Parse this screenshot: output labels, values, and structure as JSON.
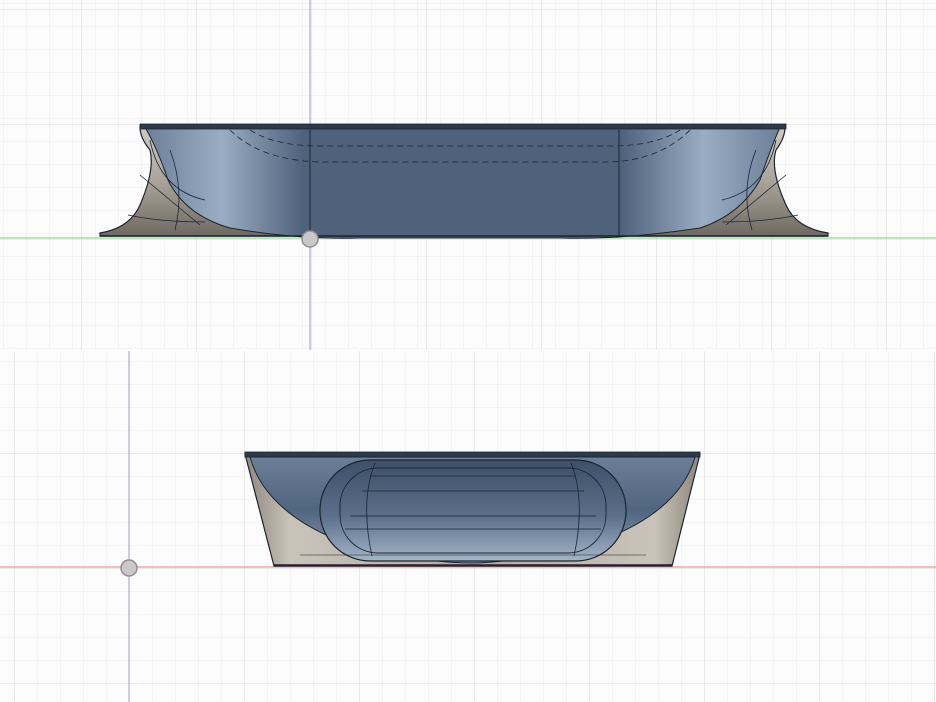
{
  "viewports": [
    {
      "id": "front",
      "axis_colors": {
        "vertical": "#9a9ae6",
        "horizontal": "#7fd07f"
      }
    },
    {
      "id": "side",
      "axis_colors": {
        "vertical": "#9a9ae6",
        "horizontal": "#e88080"
      }
    }
  ],
  "colors": {
    "background": "#fcfcfc",
    "grid_minor": "#ececec",
    "grid_major": "#d6d6d6",
    "body_metal": "#b5aea4",
    "body_dark": "#7c766e",
    "glass": "#51657f",
    "glass_light": "#8a9cb4",
    "edge": "#1b2433"
  }
}
